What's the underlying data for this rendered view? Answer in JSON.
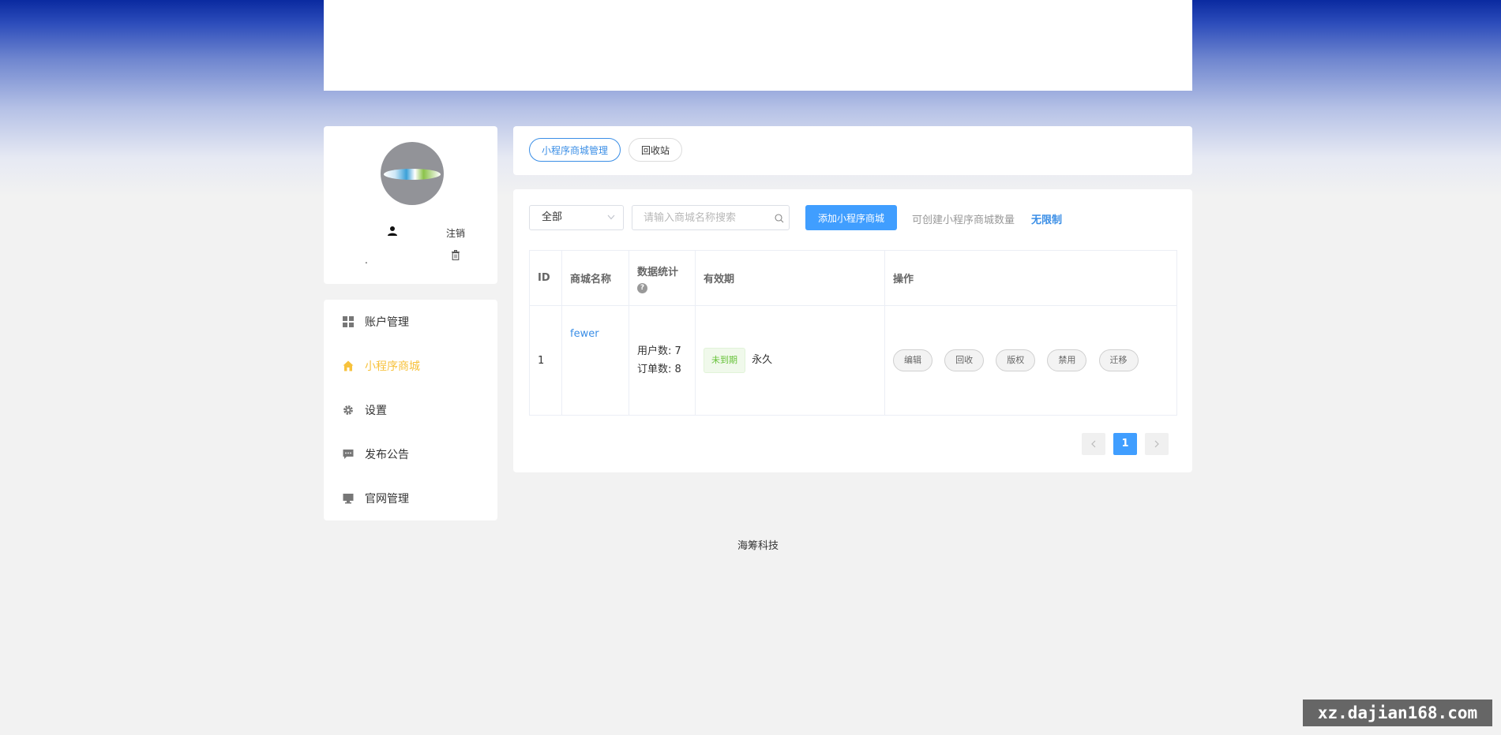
{
  "profile": {
    "logout_label": "注销",
    "username": "."
  },
  "menu": {
    "items": [
      {
        "label": "账户管理",
        "icon": "grid-icon"
      },
      {
        "label": "小程序商城",
        "icon": "home-icon",
        "active": true
      },
      {
        "label": "设置",
        "icon": "gear-icon"
      },
      {
        "label": "发布公告",
        "icon": "message-icon"
      },
      {
        "label": "官网管理",
        "icon": "monitor-icon"
      }
    ],
    "active_color": "#f7c23c"
  },
  "tabs": [
    {
      "label": "小程序商城管理",
      "active": true
    },
    {
      "label": "回收站",
      "active": false
    }
  ],
  "toolbar": {
    "filter_value": "全部",
    "search_placeholder": "请输入商城名称搜索",
    "add_button": "添加小程序商城",
    "quota_label": "可创建小程序商城数量",
    "quota_value": "无限制"
  },
  "table": {
    "headers": [
      "ID",
      "商城名称",
      "数据统计",
      "有效期",
      "操作"
    ],
    "rows": [
      {
        "id": "1",
        "name": "fewer",
        "stats": [
          "用户数: 7",
          "订单数: 8"
        ],
        "status_badge": "未到期",
        "validity": "永久",
        "actions": [
          "编辑",
          "回收",
          "版权",
          "禁用",
          "迁移"
        ]
      }
    ]
  },
  "pagination": {
    "current": "1"
  },
  "footer": "海筹科技",
  "watermark": "xz.dajian168.com",
  "colors": {
    "primary": "#409eff",
    "link": "#3a8ee6",
    "badge_green": "#67c23a"
  }
}
